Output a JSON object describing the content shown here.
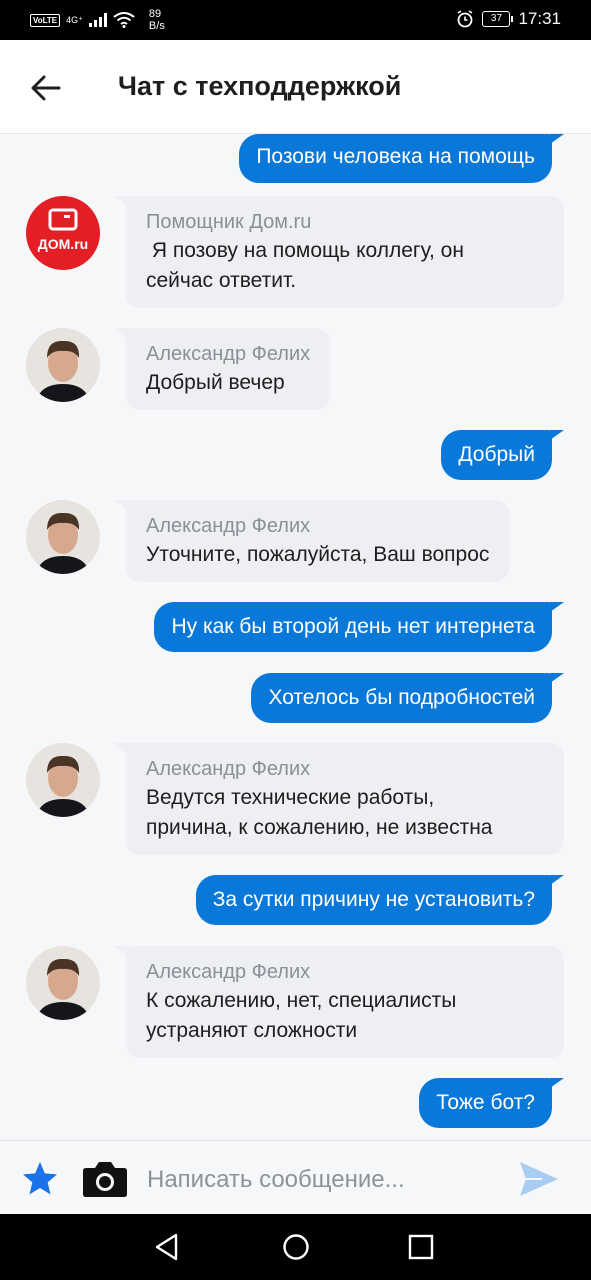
{
  "status_bar": {
    "volte": "VoLTE",
    "network": "4G⁺",
    "speed_value": "89",
    "speed_unit": "B/s",
    "battery": "37",
    "time": "17:31"
  },
  "header": {
    "title": "Чат с техподдержкой",
    "back_icon": "arrow-left-icon"
  },
  "messages": [
    {
      "direction": "out",
      "text": "Позови человека на помощь"
    },
    {
      "direction": "in",
      "avatar": "dom-ru-logo",
      "avatar_text": "ДОМ.ru",
      "sender": "Помощник Дом.ru",
      "lines": [
        " Я позову на помощь коллегу, он",
        "сейчас ответит."
      ]
    },
    {
      "direction": "in",
      "avatar": "user-photo",
      "sender": "Александр Фелих",
      "lines": [
        "Добрый вечер"
      ]
    },
    {
      "direction": "out",
      "text": "Добрый"
    },
    {
      "direction": "in",
      "avatar": "user-photo",
      "sender": "Александр Фелих",
      "lines": [
        "Уточните, пожалуйста, Ваш вопрос"
      ]
    },
    {
      "direction": "out",
      "text": "Ну как бы второй день нет интернета"
    },
    {
      "direction": "out",
      "text": "Хотелось бы подробностей"
    },
    {
      "direction": "in",
      "avatar": "user-photo",
      "sender": "Александр Фелих",
      "lines": [
        "Ведутся технические работы,",
        "причина, к сожалению, не известна"
      ]
    },
    {
      "direction": "out",
      "text": "За сутки причину не установить?"
    },
    {
      "direction": "in",
      "avatar": "user-photo",
      "sender": "Александр Фелих",
      "lines": [
        "К сожалению, нет, специалисты",
        "устраняют сложности"
      ]
    },
    {
      "direction": "out",
      "text": "Тоже бот?"
    }
  ],
  "composer": {
    "placeholder": "Написать сообщение...",
    "value": "",
    "icons": [
      "star-icon",
      "camera-icon",
      "send-icon"
    ]
  },
  "colors": {
    "outgoing_bubble": "#0a78d8",
    "incoming_bubble": "#eeeff2",
    "sender_name": "#8b8f97",
    "brand_red": "#e31e24",
    "accent_blue": "#1a73e8"
  }
}
